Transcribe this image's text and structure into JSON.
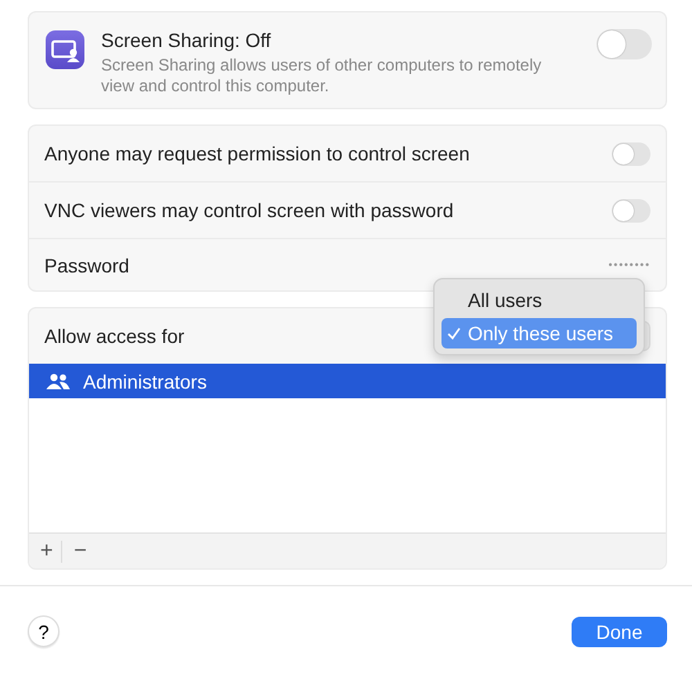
{
  "header": {
    "title": "Screen Sharing: Off",
    "description": "Screen Sharing allows users of other computers to remotely view and control this computer.",
    "on": false
  },
  "options": [
    {
      "kind": "toggle",
      "label": "Anyone may request permission to control screen",
      "on": false
    },
    {
      "kind": "toggle",
      "label": "VNC viewers may control screen with password",
      "on": false
    },
    {
      "kind": "password",
      "label": "Password",
      "value": "••••••••"
    }
  ],
  "access": {
    "label": "Allow access for",
    "users": [
      {
        "name": "Administrators",
        "selected": true
      }
    ],
    "menu": [
      {
        "label": "All users",
        "selected": false
      },
      {
        "label": "Only these users",
        "selected": true
      }
    ],
    "add": "+",
    "remove": "−"
  },
  "help": "?",
  "done": "Done"
}
